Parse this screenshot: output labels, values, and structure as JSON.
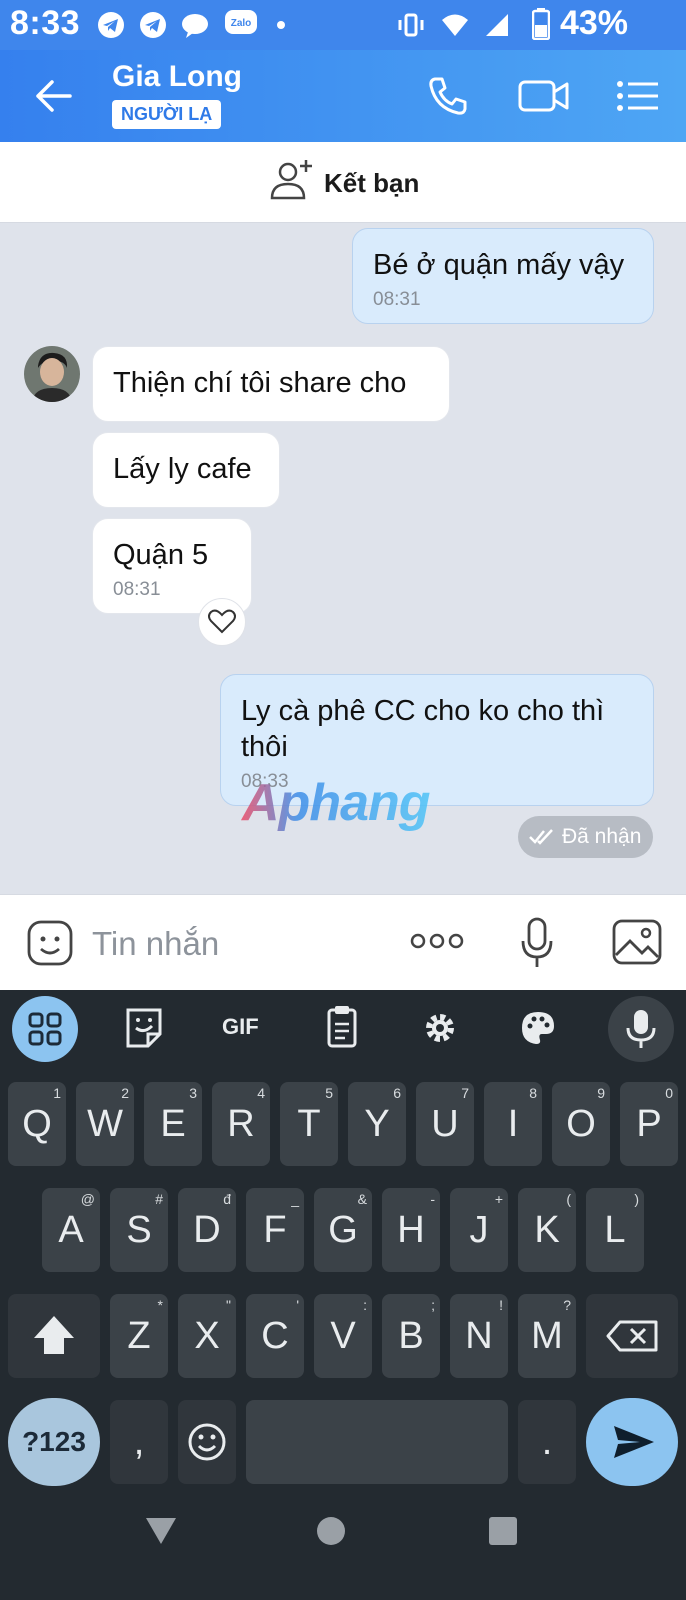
{
  "status_bar": {
    "time": "8:33",
    "battery": "43%"
  },
  "header": {
    "contact_name": "Gia Long",
    "badge": "NGƯỜI LẠ"
  },
  "friend_bar": {
    "label": "Kết bạn"
  },
  "messages": [
    {
      "direction": "outgoing",
      "text": "Bé ở quận mấy vậy",
      "time": "08:31"
    },
    {
      "direction": "incoming",
      "text": "Thiện chí tôi share cho"
    },
    {
      "direction": "incoming",
      "text": "Lấy ly cafe"
    },
    {
      "direction": "incoming",
      "text": "Quận 5",
      "time": "08:31"
    },
    {
      "direction": "outgoing",
      "text": "Ly cà phê CC cho ko cho thì thôi",
      "time": "08:33"
    }
  ],
  "delivery_status": "Đã nhận",
  "watermark": "Aphang",
  "input": {
    "placeholder": "Tin nhắn"
  },
  "keyboard": {
    "toolbar": [
      "apps-grid-icon",
      "sticker-icon",
      "GIF",
      "clipboard-icon",
      "settings-icon",
      "palette-icon",
      "mic-icon"
    ],
    "row1": [
      [
        "Q",
        "1"
      ],
      [
        "W",
        "2"
      ],
      [
        "E",
        "3"
      ],
      [
        "R",
        "4"
      ],
      [
        "T",
        "5"
      ],
      [
        "Y",
        "6"
      ],
      [
        "U",
        "7"
      ],
      [
        "I",
        "8"
      ],
      [
        "O",
        "9"
      ],
      [
        "P",
        "0"
      ]
    ],
    "row2": [
      [
        "A",
        "@"
      ],
      [
        "S",
        "#"
      ],
      [
        "D",
        "đ"
      ],
      [
        "F",
        "_"
      ],
      [
        "G",
        "&"
      ],
      [
        "H",
        "-"
      ],
      [
        "J",
        "+"
      ],
      [
        "K",
        "("
      ],
      [
        "L",
        ")"
      ]
    ],
    "row3": [
      [
        "Z",
        "*"
      ],
      [
        "X",
        "\""
      ],
      [
        "C",
        "'"
      ],
      [
        "V",
        ":"
      ],
      [
        "B",
        ";"
      ],
      [
        "N",
        "!"
      ],
      [
        "M",
        "?"
      ]
    ],
    "symbols_key": "?123",
    "comma": ",",
    "period": "."
  },
  "colors": {
    "header_start": "#3580ee",
    "header_end": "#4ea6f4",
    "outgoing_bubble": "#d9ebfc",
    "keyboard_bg": "#232a30",
    "accent_blue": "#8cc4f0"
  }
}
